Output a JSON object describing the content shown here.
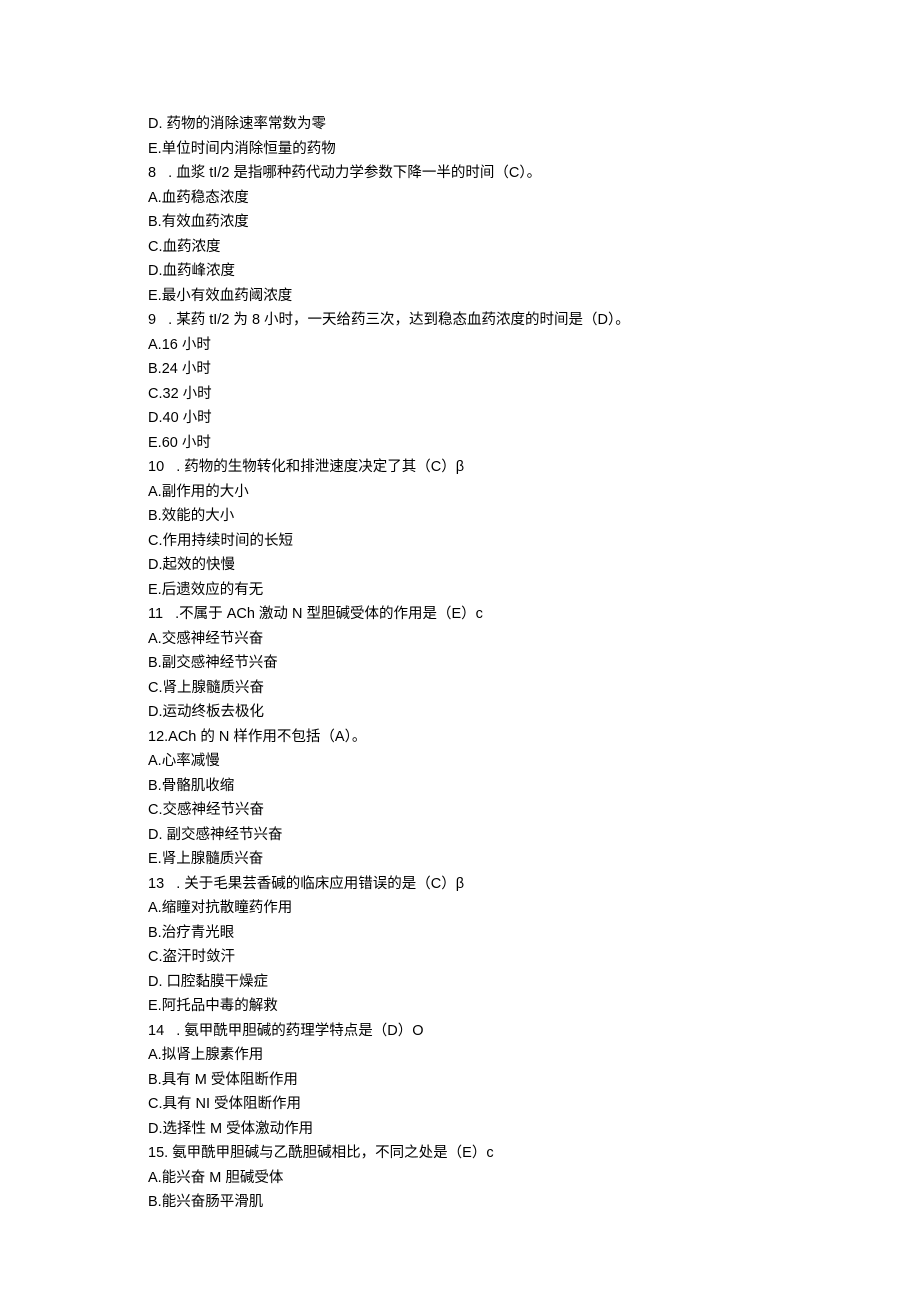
{
  "lines": [
    "D. 药物的消除速率常数为零",
    "E.单位时间内消除恒量的药物",
    "8   . 血浆 tI/2 是指哪种药代动力学参数下降一半的时间（C）。",
    "A.血药稳态浓度",
    "B.有效血药浓度",
    "C.血药浓度",
    "D.血药峰浓度",
    "E.最小有效血药阈浓度",
    "9   . 某药 tI/2 为 8 小时，一天给药三次，达到稳态血药浓度的时间是（D）。",
    "A.16 小时",
    "B.24 小时",
    "C.32 小时",
    "D.40 小时",
    "E.60 小时",
    "10   . 药物的生物转化和排泄速度决定了其（C）β",
    "A.副作用的大小",
    "B.效能的大小",
    "C.作用持续时间的长短",
    "D.起效的快慢",
    "E.后遗效应的有无",
    "11   .不属于 ACh 激动 N 型胆碱受体的作用是（E）c",
    "A.交感神经节兴奋",
    "B.副交感神经节兴奋",
    "C.肾上腺髓质兴奋",
    "D.运动终板去极化",
    "12.ACh 的 N 样作用不包括（A）。",
    "A.心率减慢",
    "B.骨骼肌收缩",
    "C.交感神经节兴奋",
    "D. 副交感神经节兴奋",
    "E.肾上腺髓质兴奋",
    "13   . 关于毛果芸香碱的临床应用错误的是（C）β",
    "A.缩瞳对抗散瞳药作用",
    "B.治疗青光眼",
    "C.盗汗时敛汗",
    "D. 口腔黏膜干燥症",
    "E.阿托品中毒的解救",
    "14   . 氨甲酰甲胆碱的药理学特点是（D）O",
    "A.拟肾上腺素作用",
    "B.具有 M 受体阻断作用",
    "C.具有 NI 受体阻断作用",
    "D.选择性 M 受体激动作用",
    "15. 氨甲酰甲胆碱与乙酰胆碱相比，不同之处是（E）c",
    "A.能兴奋 M 胆碱受体",
    "B.能兴奋肠平滑肌"
  ]
}
